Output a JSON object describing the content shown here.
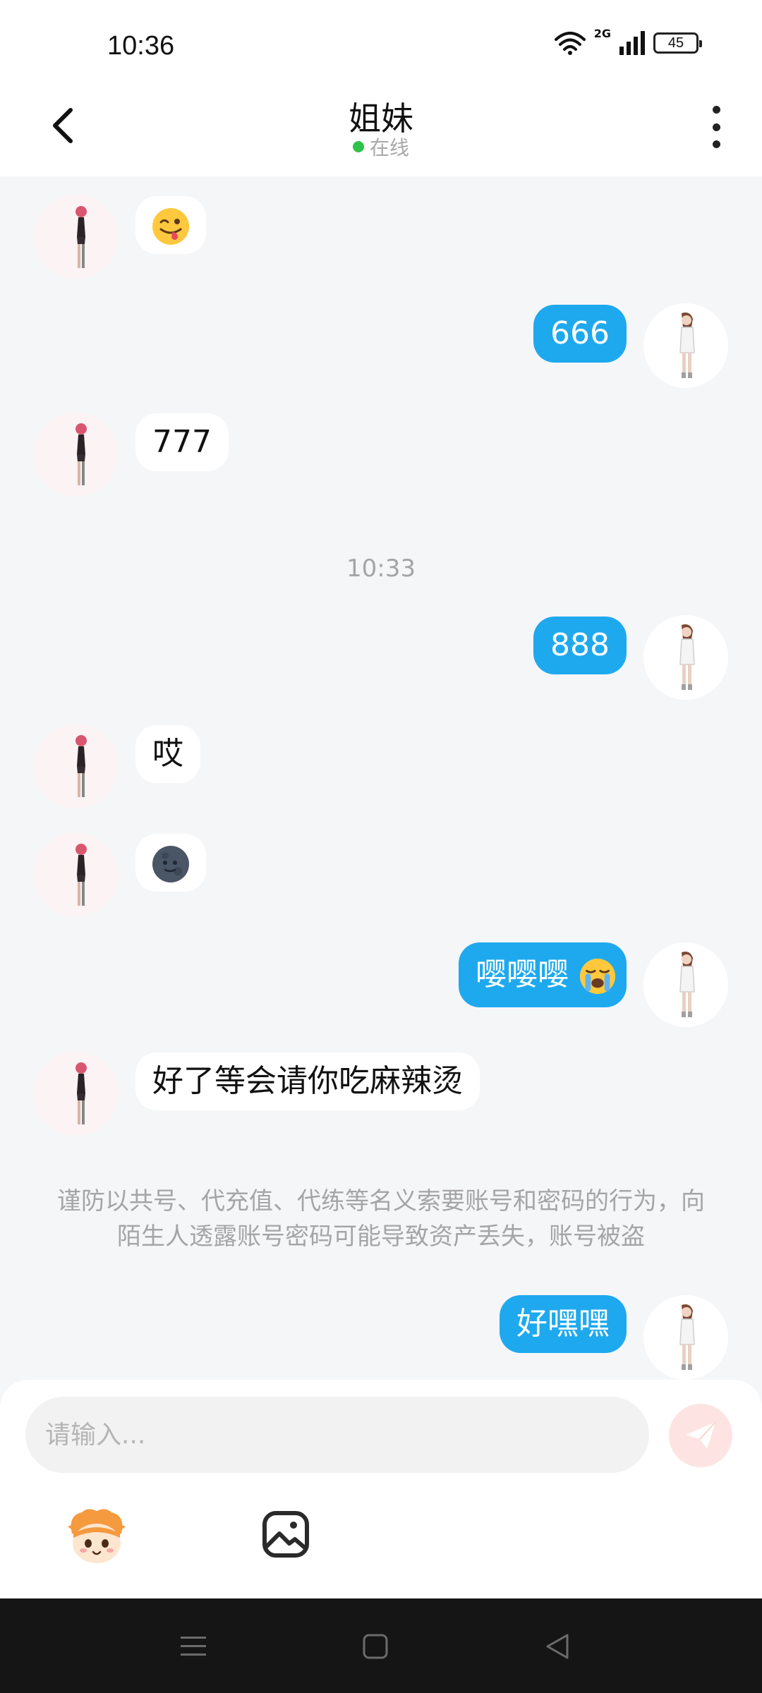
{
  "status_bar": {
    "time": "10:36",
    "network": "2G",
    "battery": "45"
  },
  "header": {
    "title": "姐妹",
    "status": "在线"
  },
  "messages": [
    {
      "side": "left",
      "text": "",
      "emoji": "winking-tongue-emoji"
    },
    {
      "side": "right",
      "text": "666"
    },
    {
      "side": "left",
      "text": "777"
    },
    {
      "side": "left",
      "text": "哎"
    },
    {
      "side": "left",
      "text": "",
      "emoji": "new-moon-face-emoji"
    },
    {
      "side": "right",
      "text": "嘤嘤嘤",
      "emoji": "loudly-crying-emoji"
    },
    {
      "side": "left",
      "text": "好了等会请你吃麻辣烫"
    },
    {
      "side": "right",
      "text": "好嘿嘿"
    },
    {
      "side": "right",
      "text": "888"
    }
  ],
  "timestamp": "10:33",
  "notice": "谨防以共号、代充值、代练等名义索要账号和密码的行为，向陌生人透露账号密码可能导致资产丢失，账号被盗",
  "input": {
    "placeholder": "请输入..."
  },
  "colors": {
    "sent_bubble": "#1ea9ee",
    "received_bubble": "#ffffff",
    "online_dot": "#2ec24a",
    "background": "#f5f6f8"
  }
}
